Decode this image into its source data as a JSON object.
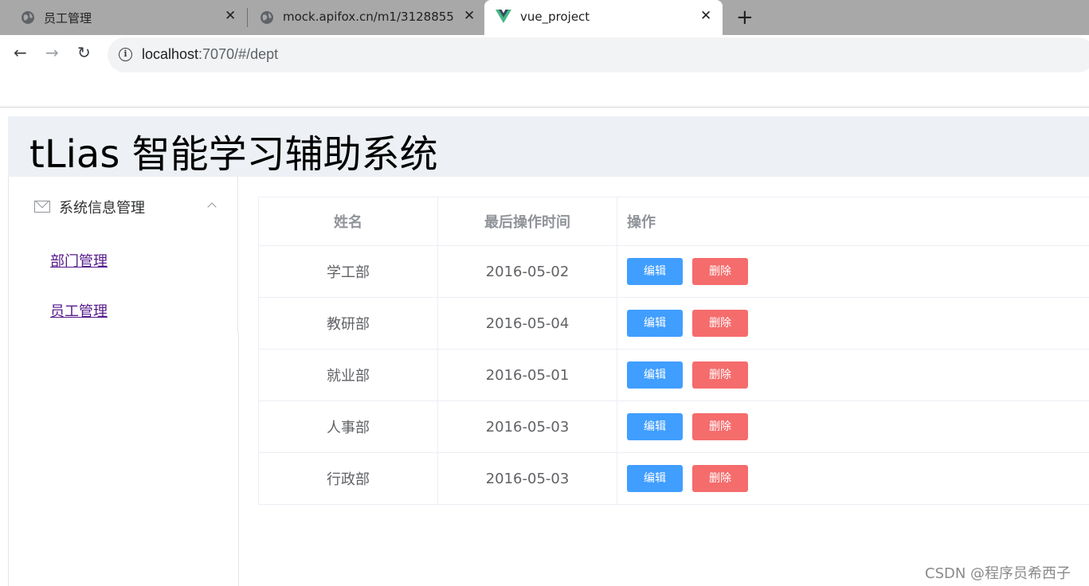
{
  "browser": {
    "tabs": [
      {
        "title": "员工管理",
        "close": "✕"
      },
      {
        "title": "mock.apifox.cn/m1/3128855-",
        "close": "✕"
      },
      {
        "title": "vue_project",
        "close": "✕"
      }
    ],
    "new_tab": "+",
    "back": "←",
    "forward": "→",
    "reload": "↻",
    "info": "i",
    "url_host": "localhost",
    "url_path": ":7070/#/dept"
  },
  "app": {
    "title": "tLias 智能学习辅助系统"
  },
  "sidebar": {
    "group_label": "系统信息管理",
    "items": [
      {
        "label": "部门管理"
      },
      {
        "label": "员工管理"
      }
    ]
  },
  "table": {
    "headers": [
      "姓名",
      "最后操作时间",
      "操作"
    ],
    "edit_label": "编辑",
    "delete_label": "删除",
    "rows": [
      {
        "name": "学工部",
        "time": "2016-05-02"
      },
      {
        "name": "教研部",
        "time": "2016-05-04"
      },
      {
        "name": "就业部",
        "time": "2016-05-01"
      },
      {
        "name": "人事部",
        "time": "2016-05-03"
      },
      {
        "name": "行政部",
        "time": "2016-05-03"
      }
    ]
  },
  "watermark": "CSDN @程序员希西子",
  "colors": {
    "primary": "#409eff",
    "danger": "#f56c6c",
    "header_bg": "#edf1f5",
    "tabbar_bg": "#a8a8a8"
  }
}
